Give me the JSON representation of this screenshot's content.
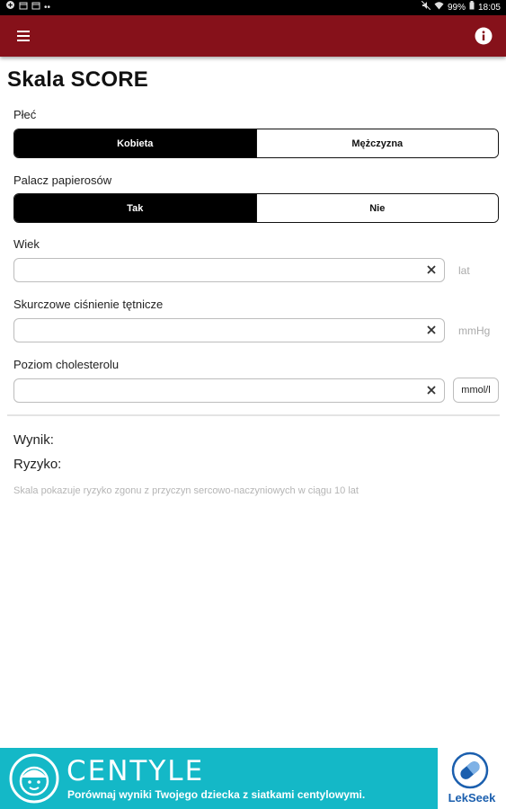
{
  "status_bar": {
    "battery": "99%",
    "time": "18:05"
  },
  "app_bar": {
    "menu_icon": "hamburger-menu-icon",
    "info_icon": "info-icon",
    "color": "#86111a"
  },
  "page": {
    "title": "Skala SCORE"
  },
  "sex": {
    "label": "Płeć",
    "options": [
      "Kobieta",
      "Mężczyzna"
    ],
    "selected": "Kobieta"
  },
  "smoker": {
    "label": "Palacz papierosów",
    "options": [
      "Tak",
      "Nie"
    ],
    "selected": "Tak"
  },
  "age": {
    "label": "Wiek",
    "value": "",
    "unit": "lat"
  },
  "pressure": {
    "label": "Skurczowe ciśnienie tętnicze",
    "value": "",
    "unit": "mmHg"
  },
  "cholesterol": {
    "label": "Poziom cholesterolu",
    "value": "",
    "unit": "mmol/l"
  },
  "results": {
    "score_label": "Wynik:",
    "risk_label": "Ryzyko:",
    "note": "Skala pokazuje ryzyko zgonu z przyczyn sercowo-naczyniowych w ciągu 10 lat"
  },
  "ad": {
    "brand": "CENTYLE",
    "tagline": "Porównaj wyniki Twojego dziecka z siatkami centylowymi.",
    "side_brand": "LekSeek",
    "color": "#14b8c7"
  }
}
